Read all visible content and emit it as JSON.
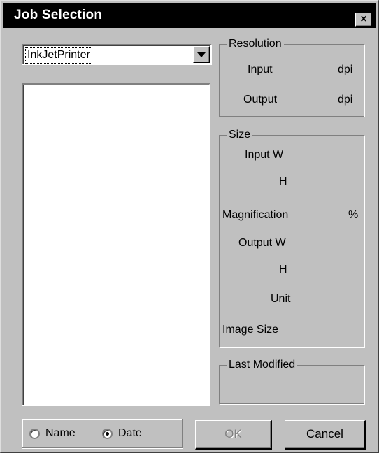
{
  "window": {
    "title": "Job Selection",
    "close_label": "×"
  },
  "job_select": {
    "value": "InkJetPrinter"
  },
  "resolution": {
    "legend": "Resolution",
    "input_label": "Input",
    "input_unit": "dpi",
    "output_label": "Output",
    "output_unit": "dpi"
  },
  "size": {
    "legend": "Size",
    "input_w_label": "Input W",
    "input_h_label": "H",
    "magnification_label": "Magnification",
    "magnification_unit": "%",
    "output_w_label": "Output W",
    "output_h_label": "H",
    "unit_label": "Unit",
    "image_size_label": "Image Size"
  },
  "last_modified": {
    "legend": "Last Modified"
  },
  "sort": {
    "name_label": "Name",
    "date_label": "Date",
    "selected": "Date"
  },
  "buttons": {
    "ok_label": "OK",
    "cancel_label": "Cancel"
  }
}
